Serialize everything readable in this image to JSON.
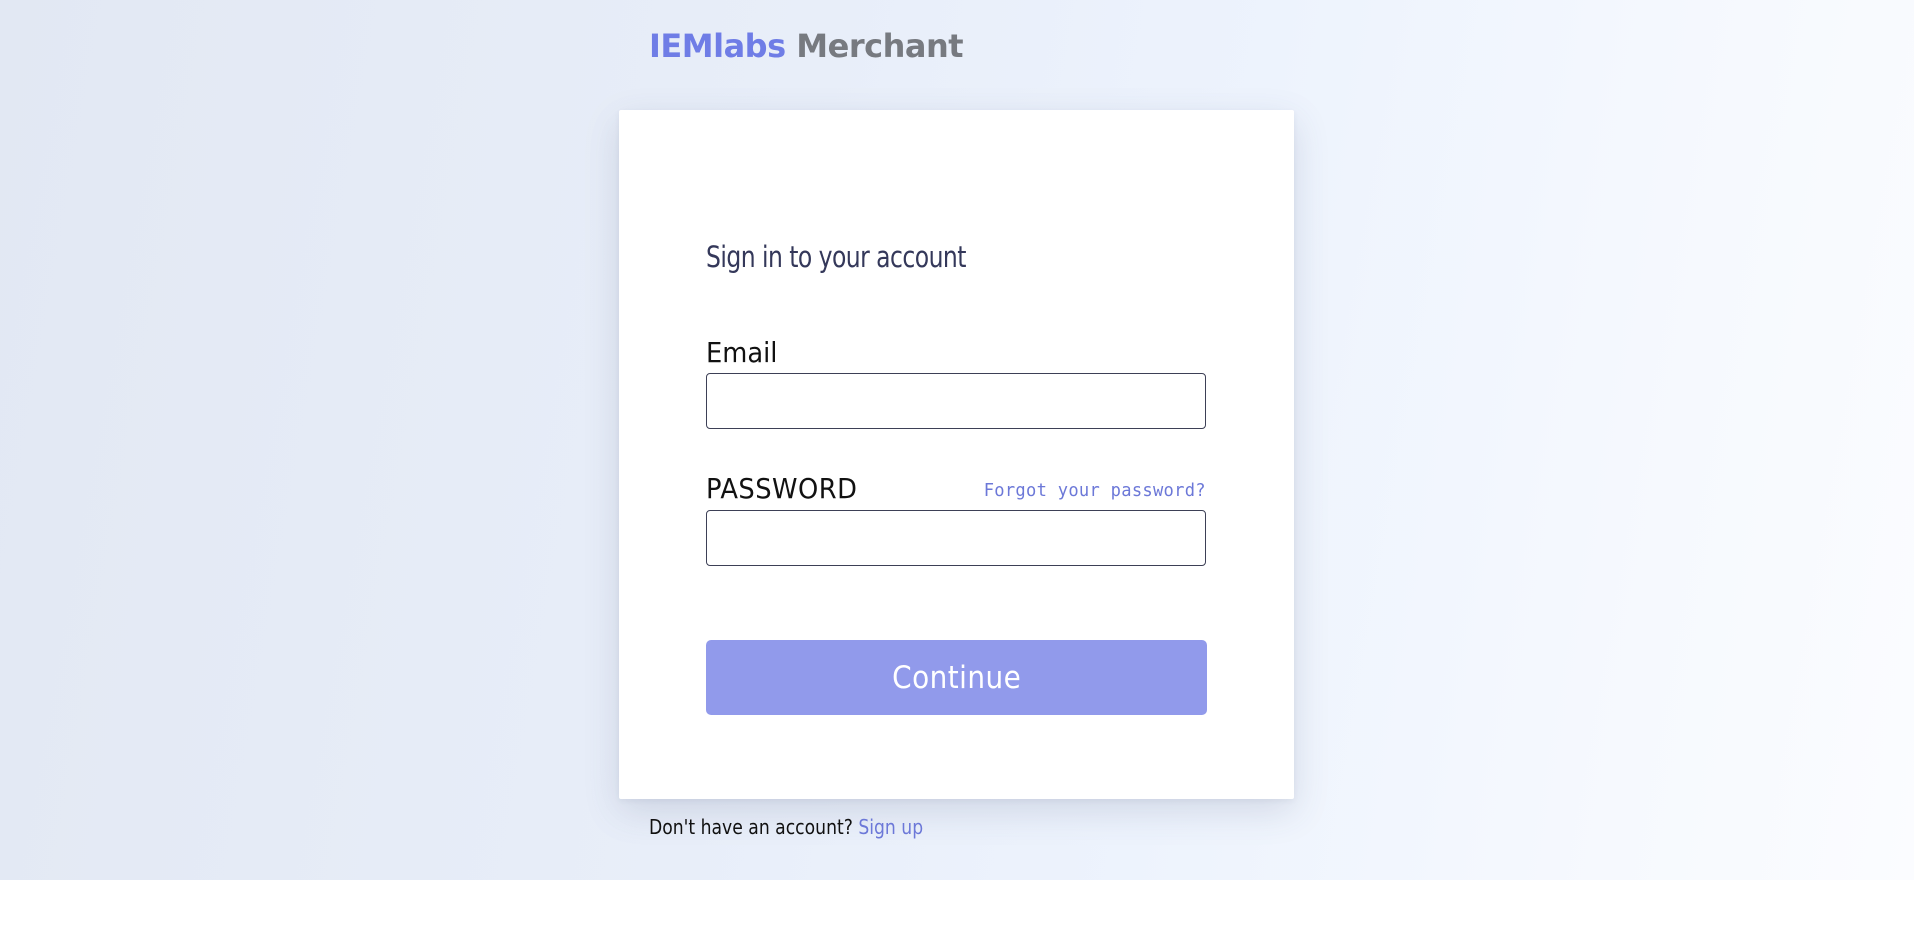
{
  "brand": {
    "primary": "IEMlabs",
    "secondary": "Merchant",
    "primary_color": "#6f7de6",
    "secondary_color": "#777a80"
  },
  "signin": {
    "heading": "Sign in to your account",
    "email_label": "Email",
    "email_value": "",
    "password_label": "PASSWORD",
    "password_value": "",
    "forgot_link": "Forgot your password?",
    "continue_label": "Continue",
    "button_color": "#919aeb"
  },
  "footer": {
    "no_account_text": "Don't have an account?",
    "signup_link": "Sign up",
    "link_color": "#6c78d8"
  }
}
